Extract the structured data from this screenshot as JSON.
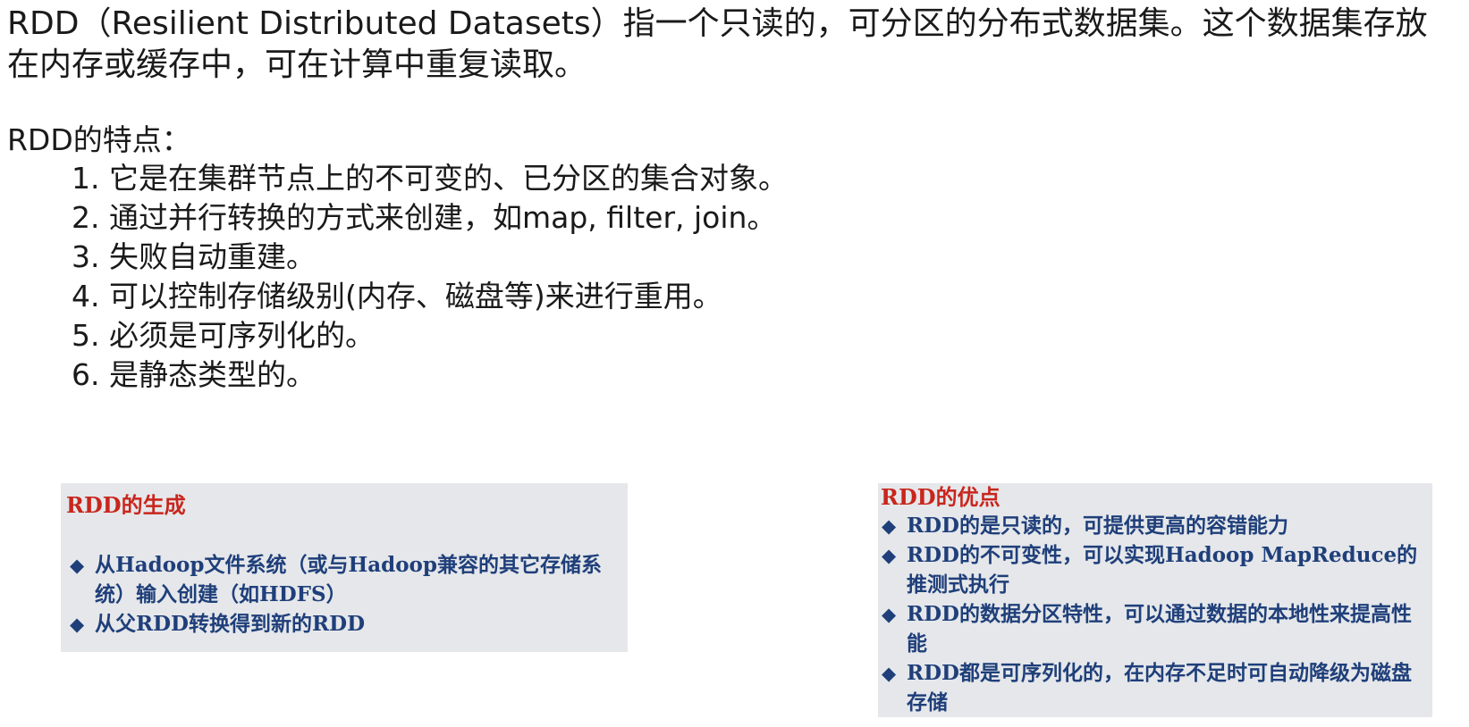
{
  "intro": {
    "text": "RDD（Resilient Distributed Datasets）指一个只读的，可分区的分布式数据集。这个数据集存放在内存或缓存中，可在计算中重复读取。"
  },
  "features": {
    "title": "RDD的特点：",
    "items": [
      "1. 它是在集群节点上的不可变的、已分区的集合对象。",
      "2. 通过并行转换的方式来创建，如map, filter, join。",
      "3. 失败自动重建。",
      "4. 可以控制存储级别(内存、磁盘等)来进行重用。",
      "5. 必须是可序列化的。",
      "6. 是静态类型的。"
    ]
  },
  "generation_box": {
    "title": "RDD的生成",
    "bullet_icon": "diamond-bullet-icon",
    "items": [
      "从Hadoop文件系统（或与Hadoop兼容的其它存储系统）输入创建（如HDFS）",
      "从父RDD转换得到新的RDD"
    ]
  },
  "advantages_box": {
    "title": "RDD的优点",
    "bullet_icon": "diamond-bullet-icon",
    "items": [
      "RDD的是只读的，可提供更高的容错能力",
      "RDD的不可变性，可以实现Hadoop MapReduce的推测式执行",
      "RDD的数据分区特性，可以通过数据的本地性来提高性能",
      "RDD都是可序列化的，在内存不足时可自动降级为磁盘存储"
    ]
  },
  "colors": {
    "box_background": "#e5e7ea",
    "box_title": "#c8261d",
    "box_text": "#1f3f7a"
  }
}
